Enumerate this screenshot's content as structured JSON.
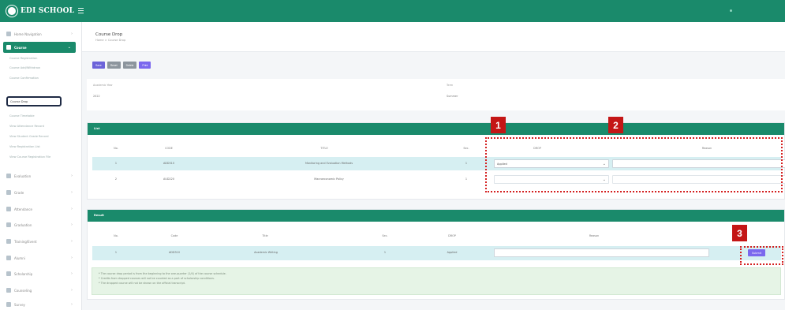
{
  "app": {
    "brand": "EDI SCHOOL"
  },
  "sidebar": {
    "items": [
      {
        "label": "Home Navigation",
        "icon": "dashboard-icon"
      },
      {
        "label": "Course",
        "icon": "book-icon",
        "active": true
      },
      {
        "label": "Evaluation",
        "icon": "pencil-icon"
      },
      {
        "label": "Grade",
        "icon": "chart-icon"
      },
      {
        "label": "Attendance",
        "icon": "bar-chart-icon"
      },
      {
        "label": "Graduation",
        "icon": "graduation-icon"
      },
      {
        "label": "Training/Event",
        "icon": "calendar-icon"
      },
      {
        "label": "Alumni",
        "icon": "users-icon"
      },
      {
        "label": "Scholarship",
        "icon": "award-icon"
      },
      {
        "label": "Counseling",
        "icon": "chat-icon"
      },
      {
        "label": "Survey",
        "icon": "clipboard-icon"
      }
    ],
    "course_subitems": [
      "Course Registration",
      "Course Add/Withdraw",
      "Course Confirmation",
      "Course Drop",
      "Course Timetable",
      "View Attendance Record",
      "View Student Grade Record",
      "View Registration List",
      "View Course Registration File"
    ]
  },
  "header": {
    "title": "Course Drop",
    "breadcrumb": "Home > Course Drop"
  },
  "toolbar": {
    "buttons": [
      "Save",
      "Reset",
      "Delete",
      "Print"
    ]
  },
  "info": {
    "academic_year_label": "Academic Year",
    "academic_year_value": "2022",
    "term_label": "Term",
    "term_value": "Summer"
  },
  "list_panel": {
    "title": "List",
    "columns": [
      "No.",
      "CODE",
      "TITLE",
      "Sec.",
      "DROP",
      "Reason"
    ],
    "rows": [
      {
        "no": "1",
        "code": "ADD310",
        "title": "Monitoring and Evaluation Methods",
        "sec": "1",
        "drop": "Applied"
      },
      {
        "no": "2",
        "code": "AUD220",
        "title": "Macroeconomic Policy",
        "sec": "1",
        "drop": ""
      }
    ]
  },
  "result_panel": {
    "title": "Result",
    "columns": [
      "No.",
      "Code",
      "Title",
      "Sec.",
      "DROP",
      "Reason"
    ],
    "rows": [
      {
        "no": "1",
        "code": "ADD310",
        "title": "Academic Writing",
        "sec": "1",
        "drop": "Applied",
        "action": "Submit"
      }
    ],
    "notes": [
      "* The course drop period is from the beginning to the one-quarter (1/4) of the course schedule.",
      "* Credits from dropped courses will not be counted as a part of scholarship conditions.",
      "* The dropped course will not be shown on the official transcript."
    ]
  },
  "markers": [
    "1",
    "2",
    "3"
  ],
  "colors": {
    "brand": "#1a8a6b",
    "accent": "#7b68ee",
    "marker": "#c41616",
    "highlight_row": "#d6eff2",
    "note_bg": "#e6f4e6"
  }
}
